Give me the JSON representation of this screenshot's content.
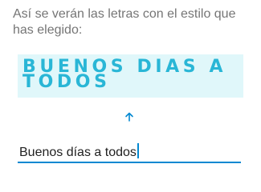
{
  "instruction": {
    "text": "Así se verán las letras con el estilo que has elegido:"
  },
  "preview": {
    "text": "BUENOS DIAS A TODOS"
  },
  "direction_icon": "arrow-up-icon",
  "input": {
    "value": "Buenos días a todos"
  },
  "colors": {
    "preview_background": "#e0f7fa",
    "preview_text": "#29b6d6",
    "accent": "#0288d1"
  }
}
